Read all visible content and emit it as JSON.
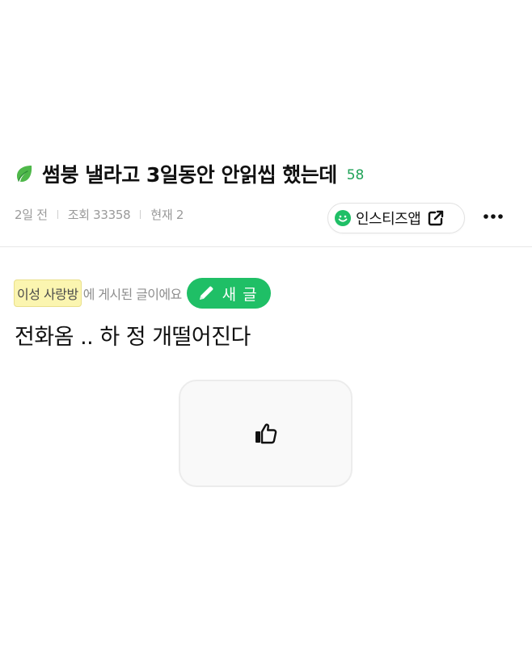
{
  "post": {
    "title": "썸붕 낼라고 3일동안 안읽씹 했는데",
    "comment_count": "58",
    "time_ago": "2일 전",
    "views": "조회 33358",
    "current_viewers": "현재 2",
    "content": "전화옴 .. 하 정 개떨어진다"
  },
  "header": {
    "app_button_label": "인스티즈앱",
    "more_icon": "more-horizontal-icon",
    "leaf_icon": "leaf-icon",
    "smile_icon": "smile-icon",
    "external_icon": "external-link-icon"
  },
  "board": {
    "name": "이성 사랑방",
    "suffix": "에 게시된 글이에요",
    "new_post_label": "새 글",
    "pencil_icon": "pencil-icon"
  },
  "like": {
    "icon": "thumbs-up-icon"
  },
  "colors": {
    "accent_green": "#1fbf66",
    "count_green": "#1fa257",
    "board_chip_bg": "#fbf5b0",
    "meta_gray": "#9a9a9a"
  }
}
